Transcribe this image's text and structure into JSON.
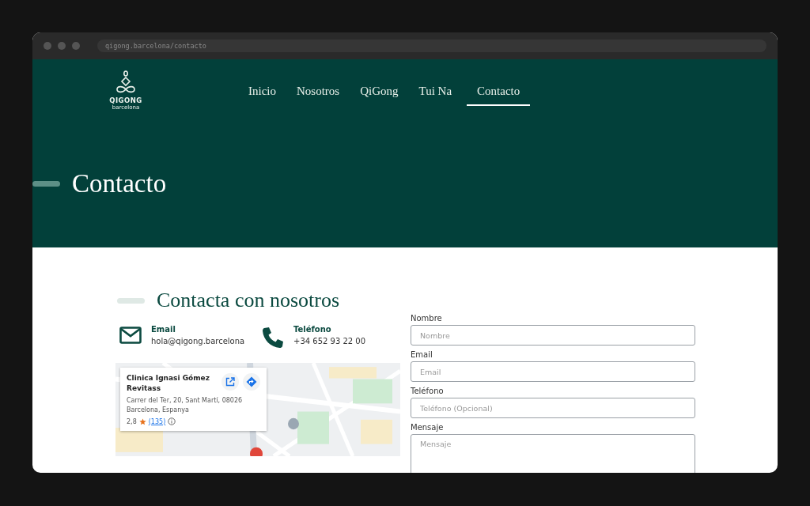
{
  "browser": {
    "url": "qigong.barcelona/contacto"
  },
  "logo": {
    "name": "QIGONG",
    "sub": "barcelona"
  },
  "nav": [
    {
      "label": "Inicio",
      "selected": false
    },
    {
      "label": "Nosotros",
      "selected": false
    },
    {
      "label": "QiGong",
      "selected": false
    },
    {
      "label": "Tui Na",
      "selected": false
    },
    {
      "label": "Contacto",
      "selected": true
    }
  ],
  "hero": {
    "title": "Contacto"
  },
  "section": {
    "title": "Contacta con nosotros"
  },
  "contacts": [
    {
      "kind": "email",
      "label": "Email",
      "value": "hola@qigong.barcelona"
    },
    {
      "kind": "phone",
      "label": "Teléfono",
      "value": "+34 652 93 22 00"
    }
  ],
  "map_card": {
    "name": "Clinica Ignasi Gómez Revitass",
    "address": "Carrer del Ter, 20, Sant Martí, 08026 Barcelona, Espanya",
    "rating": "2,8",
    "reviews": "(135)"
  },
  "form": [
    {
      "label": "Nombre",
      "placeholder": "Nombre",
      "kind": "input"
    },
    {
      "label": "Email",
      "placeholder": "Email",
      "kind": "input"
    },
    {
      "label": "Teléfono",
      "placeholder": "Teléfono (Opcional)",
      "kind": "input"
    },
    {
      "label": "Mensaje",
      "placeholder": "Mensaje",
      "kind": "textarea"
    }
  ]
}
